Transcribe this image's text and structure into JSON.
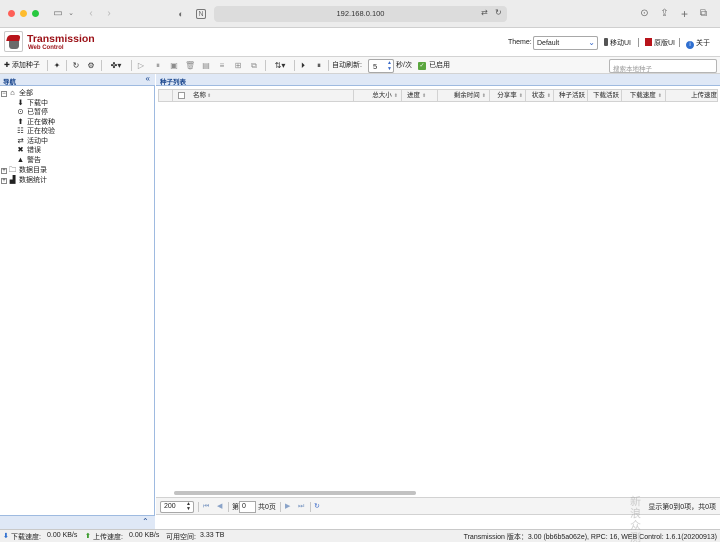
{
  "browser": {
    "url": "192.168.0.100"
  },
  "header": {
    "title": "Transmission",
    "subtitle": "Web Control",
    "theme_label": "Theme:",
    "theme_value": "Default",
    "links": [
      "移动UI",
      "原版UI",
      "关于"
    ]
  },
  "toolbar": {
    "add_torrent": "添加种子",
    "auto_refresh_label": "自动刷新:",
    "refresh_value": "5",
    "refresh_unit": "秒/次",
    "enabled_label": "已启用",
    "search_placeholder": "搜索本地种子"
  },
  "nav": {
    "title": "导航",
    "items": [
      {
        "label": "全部",
        "icon": "home-icon"
      },
      {
        "label": "下载中",
        "icon": "download-icon"
      },
      {
        "label": "已暂停",
        "icon": "pause-icon"
      },
      {
        "label": "正在做种",
        "icon": "upload-icon"
      },
      {
        "label": "正在校验",
        "icon": "verify-icon"
      },
      {
        "label": "活动中",
        "icon": "activity-icon"
      },
      {
        "label": "错误",
        "icon": "error-icon"
      },
      {
        "label": "警告",
        "icon": "warning-icon"
      },
      {
        "label": "数据目录",
        "icon": "folder-icon"
      },
      {
        "label": "数据统计",
        "icon": "stats-icon"
      }
    ]
  },
  "main": {
    "title": "种子列表",
    "columns": [
      "名称",
      "总大小",
      "进度",
      "剩余时间",
      "分享率",
      "状态",
      "种子活跃",
      "下载活跃",
      "下载速度",
      "上传速度"
    ]
  },
  "pager": {
    "page_size": "200",
    "page_prefix": "第",
    "page_value": "0",
    "page_total": "共0页",
    "right_text": "显示第0到0项，共0项"
  },
  "status": {
    "download_label": "下载速度:",
    "download_value": "0.00 KB/s",
    "upload_label": "上传速度:",
    "upload_value": "0.00 KB/s",
    "free_label": "可用空间:",
    "free_value": "3.33 TB",
    "version": "Transmission 版本：3.00 (bb6b5a062e), RPC: 16, WEB Control: 1.6.1(20200913)"
  },
  "watermark": "新\n浪\n众\n测"
}
